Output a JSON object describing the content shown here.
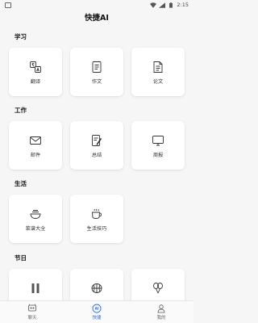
{
  "status_bar": {
    "time": "2:15"
  },
  "app": {
    "title": "快捷AI"
  },
  "sections": [
    {
      "title": "学习",
      "items": [
        {
          "label": "翻译",
          "icon": "translate-icon"
        },
        {
          "label": "作文",
          "icon": "document-icon"
        },
        {
          "label": "论文",
          "icon": "paper-icon"
        }
      ]
    },
    {
      "title": "工作",
      "items": [
        {
          "label": "邮件",
          "icon": "mail-icon"
        },
        {
          "label": "总结",
          "icon": "summary-icon"
        },
        {
          "label": "周报",
          "icon": "monitor-icon"
        }
      ]
    },
    {
      "title": "生活",
      "items": [
        {
          "label": "菜谱大全",
          "icon": "bowl-icon"
        },
        {
          "label": "生活技巧",
          "icon": "cup-icon"
        }
      ]
    },
    {
      "title": "节日",
      "items": [
        {
          "label": "",
          "icon": "pause-icon"
        },
        {
          "label": "",
          "icon": "lantern-icon"
        },
        {
          "label": "",
          "icon": "balloon-icon"
        }
      ]
    }
  ],
  "bottom_nav": [
    {
      "label": "聊天",
      "icon": "chat-icon"
    },
    {
      "label": "快捷",
      "icon": "ai-icon",
      "active": true
    },
    {
      "label": "我的",
      "icon": "user-icon"
    }
  ],
  "colors": {
    "accent": "#2f6fe6",
    "background": "#f6f6f6",
    "card": "#ffffff"
  }
}
